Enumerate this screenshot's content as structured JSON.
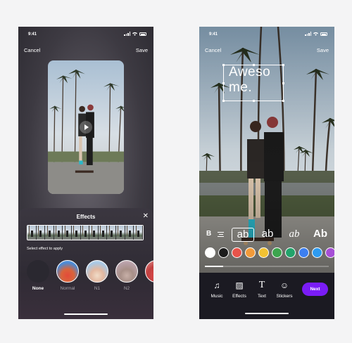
{
  "status": {
    "time": "9:41"
  },
  "left_screen": {
    "cancel_label": "Cancel",
    "save_label": "Save",
    "sheet": {
      "title": "Effects",
      "close_glyph": "✕",
      "hint": "Select effect to apply",
      "effects": [
        {
          "label": "None",
          "selected": true
        },
        {
          "label": "Normal",
          "selected": false
        },
        {
          "label": "N1",
          "selected": false
        },
        {
          "label": "N2",
          "selected": false
        }
      ]
    }
  },
  "right_screen": {
    "cancel_label": "Cancel",
    "save_label": "Save",
    "overlay_text": "Aweso me.",
    "format": {
      "bold": "B",
      "styles": [
        "ab",
        "ab",
        "ab",
        "Ab"
      ]
    },
    "colors": [
      "#ffffff",
      "#1c1c1c",
      "#e8534a",
      "#f29a3a",
      "#f2c232",
      "#3da54e",
      "#22a36b",
      "#3d7ff0",
      "#2e9bf0",
      "#a64fd6"
    ],
    "progress": 0.15,
    "tools": [
      {
        "label": "Music",
        "icon": "music-icon",
        "glyph": "♫"
      },
      {
        "label": "Effects",
        "icon": "effects-icon",
        "glyph": "▨"
      },
      {
        "label": "Text",
        "icon": "text-icon",
        "glyph": "T"
      },
      {
        "label": "Stickers",
        "icon": "sticker-icon",
        "glyph": "☺"
      }
    ],
    "next_label": "Next",
    "accent": "#7a1cf6"
  }
}
